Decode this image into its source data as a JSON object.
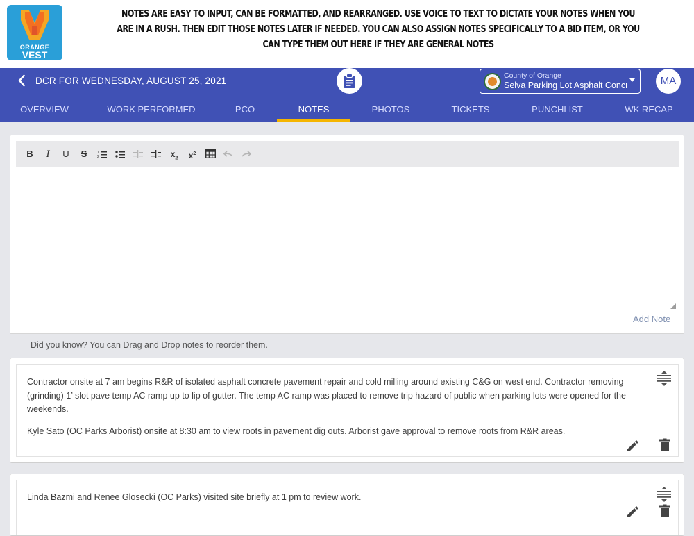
{
  "banner": {
    "logo_word1": "ORANGE",
    "logo_word2": "VEST",
    "caption": "NOTES ARE EASY TO INPUT, CAN BE FORMATTED, AND REARRANGED. USE VOICE TO TEXT TO DICTATE YOUR NOTES WHEN YOU ARE IN A RUSH. THEN EDIT THOSE NOTES LATER IF NEEDED. YOU CAN ALSO ASSIGN NOTES SPECIFICALLY TO A BID ITEM, OR YOU CAN TYPE THEM OUT HERE IF THEY ARE GENERAL NOTES"
  },
  "header": {
    "title": "DCR FOR WEDNESDAY, AUGUST 25, 2021",
    "org": "County of Orange",
    "project": "Selva Parking Lot Asphalt Concrete",
    "avatar": "MA"
  },
  "tabs": [
    {
      "label": "OVERVIEW"
    },
    {
      "label": "WORK PERFORMED"
    },
    {
      "label": "PCO"
    },
    {
      "label": "NOTES"
    },
    {
      "label": "PHOTOS"
    },
    {
      "label": "TICKETS"
    },
    {
      "label": "PUNCHLIST"
    },
    {
      "label": "WK RECAP"
    }
  ],
  "active_tab": "NOTES",
  "editor": {
    "toolbar": [
      {
        "icon": "bold-icon",
        "glyph": "B"
      },
      {
        "icon": "italic-icon",
        "glyph": "I"
      },
      {
        "icon": "underline-icon",
        "glyph": "U"
      },
      {
        "icon": "strikethrough-icon",
        "glyph": "S"
      },
      {
        "icon": "ordered-list-icon"
      },
      {
        "icon": "bullet-list-icon"
      },
      {
        "icon": "outdent-icon"
      },
      {
        "icon": "indent-icon"
      },
      {
        "icon": "subscript-icon"
      },
      {
        "icon": "superscript-icon"
      },
      {
        "icon": "table-icon"
      },
      {
        "icon": "undo-icon"
      },
      {
        "icon": "redo-icon"
      }
    ],
    "add_note_label": "Add Note"
  },
  "tip": "Did you know? You can Drag and Drop notes to reorder them.",
  "notes": [
    {
      "paragraphs": [
        "Contractor onsite at 7 am begins R&R of isolated asphalt concrete pavement repair and cold milling around existing C&G on west end. Contractor removing (grinding) 1’ slot pave temp AC ramp up to lip of gutter. The temp AC ramp was placed to remove trip hazard of public when parking lots were opened for the weekends.",
        "Kyle Sato (OC Parks Arborist) onsite at 8:30 am to view roots in pavement dig outs. Arborist gave approval to remove roots from R&R areas."
      ]
    },
    {
      "paragraphs": [
        "Linda Bazmi and Renee Glosecki (OC Parks) visited site briefly at 1 pm to review work."
      ]
    }
  ],
  "colors": {
    "app_bar": "#4051b5",
    "active_tab_indicator": "#f5b500",
    "logo_bg": "#2a9fd8"
  }
}
